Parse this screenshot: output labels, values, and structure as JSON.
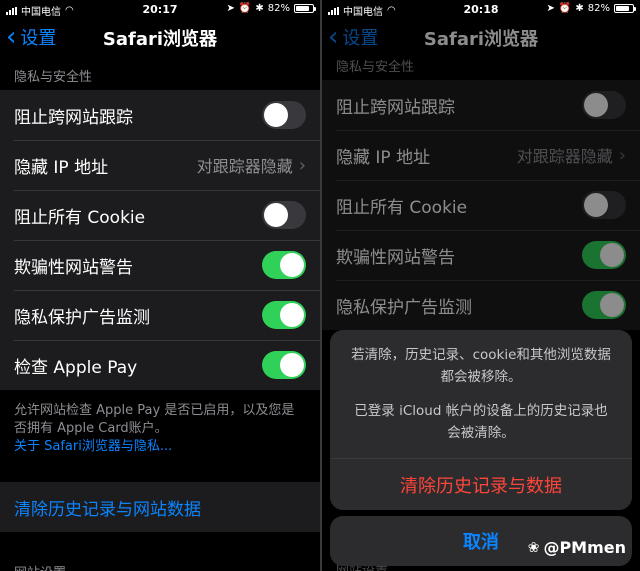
{
  "left": {
    "status": {
      "carrier": "中国电信",
      "time": "20:17",
      "battery": "82%",
      "battery_level": 0.82
    },
    "nav": {
      "back_label": "设置",
      "title": "Safari浏览器"
    },
    "section_header": "隐私与安全性",
    "rows": [
      {
        "label": "阻止跨网站跟踪",
        "toggle": false
      },
      {
        "label": "隐藏 IP 地址",
        "value": "对跟踪器隐藏"
      },
      {
        "label": "阻止所有 Cookie",
        "toggle": false
      },
      {
        "label": "欺骗性网站警告",
        "toggle": true
      },
      {
        "label": "隐私保护广告监测",
        "toggle": true
      },
      {
        "label": "检查 Apple Pay",
        "toggle": true
      }
    ],
    "footnote": "允许网站检查 Apple Pay 是否已启用，以及您是否拥有 Apple Card账户。",
    "footnote_link": "关于 Safari浏览器与隐私...",
    "clear_label": "清除历史记录与网站数据",
    "next_section": "网站设置"
  },
  "right": {
    "status": {
      "carrier": "中国电信",
      "time": "20:18",
      "battery": "82%",
      "battery_level": 0.82
    },
    "nav": {
      "back_label": "设置",
      "title": "Safari浏览器"
    },
    "section_header": "隐私与安全性",
    "rows": [
      {
        "label": "阻止跨网站跟踪",
        "toggle": false
      },
      {
        "label": "隐藏 IP 地址",
        "value": "对跟踪器隐藏"
      },
      {
        "label": "阻止所有 Cookie",
        "toggle": false
      },
      {
        "label": "欺骗性网站警告",
        "toggle": true
      },
      {
        "label": "隐私保护广告监测",
        "toggle": true
      }
    ],
    "sheet": {
      "message1": "若清除，历史记录、cookie和其他浏览数据都会被移除。",
      "message2": "已登录 iCloud 帐户的设备上的历史记录也会被清除。",
      "destructive": "清除历史记录与数据",
      "cancel": "取消"
    },
    "next_section": "网站设置"
  },
  "watermark": "@PMmen",
  "colors": {
    "accent": "#0a84ff",
    "toggle_on": "#30d158",
    "destructive": "#ff453a",
    "group_bg": "#1c1c1e"
  }
}
